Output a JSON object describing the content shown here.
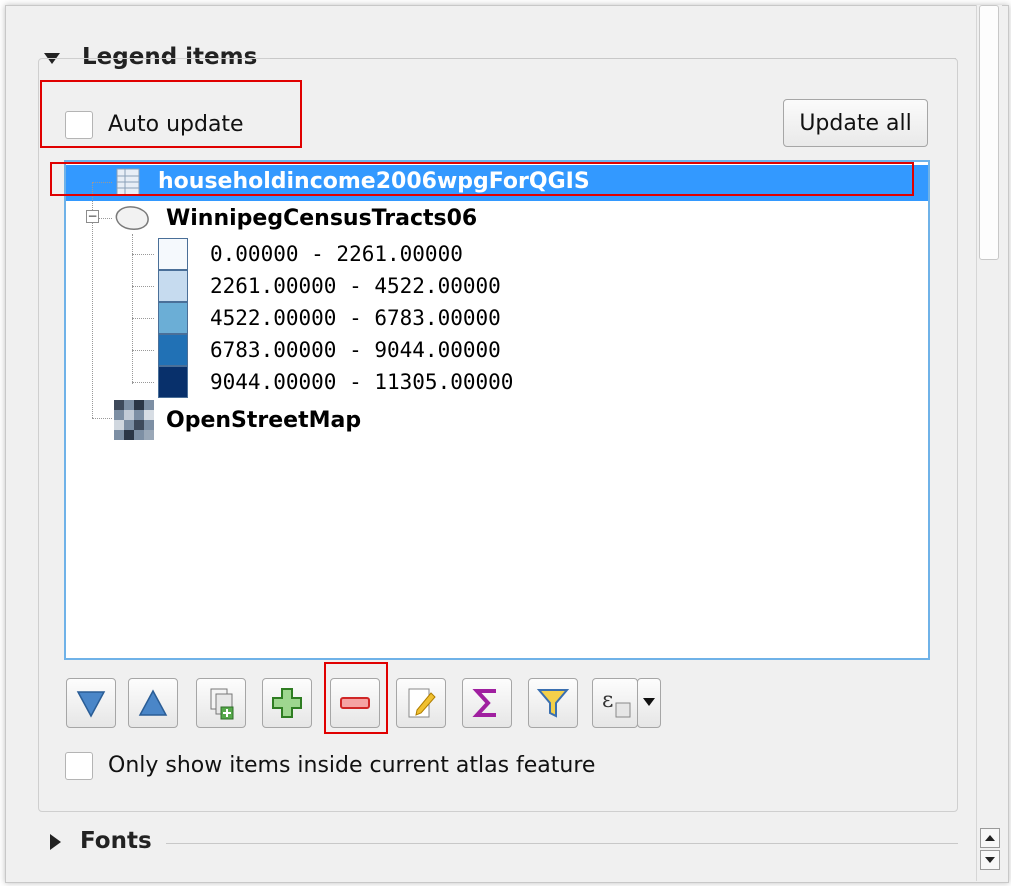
{
  "legend_section": {
    "title": "Legend items",
    "auto_update_label": "Auto update",
    "auto_update_checked": false,
    "update_all_label": "Update all"
  },
  "tree": {
    "items": [
      {
        "label": "householdincome2006wpgForQGIS",
        "icon": "table-icon",
        "selected": true
      },
      {
        "label": "WinnipegCensusTracts06",
        "icon": "polygon-layer-icon",
        "expanded": true,
        "classes": [
          {
            "label": "0.00000 - 2261.00000",
            "color": "#f5f9fd"
          },
          {
            "label": "2261.00000 - 4522.00000",
            "color": "#c6dbef"
          },
          {
            "label": "4522.00000 - 6783.00000",
            "color": "#6baed6"
          },
          {
            "label": "6783.00000 - 9044.00000",
            "color": "#2171b5"
          },
          {
            "label": "9044.00000 - 11305.00000",
            "color": "#08306b"
          }
        ]
      },
      {
        "label": "OpenStreetMap",
        "icon": "raster-layer-icon"
      }
    ]
  },
  "toolbar": {
    "buttons": [
      "move-down-icon",
      "move-up-icon",
      "add-group-icon",
      "add-item-icon",
      "remove-item-icon",
      "edit-icon",
      "sum-icon",
      "filter-icon",
      "expression-icon"
    ]
  },
  "atlas_filter": {
    "label": "Only show items inside current atlas feature",
    "checked": false
  },
  "fonts_section": {
    "title": "Fonts"
  },
  "colors": {
    "selection": "#3399ff",
    "highlight_box": "#e00000",
    "tree_border": "#6fb2e8"
  }
}
